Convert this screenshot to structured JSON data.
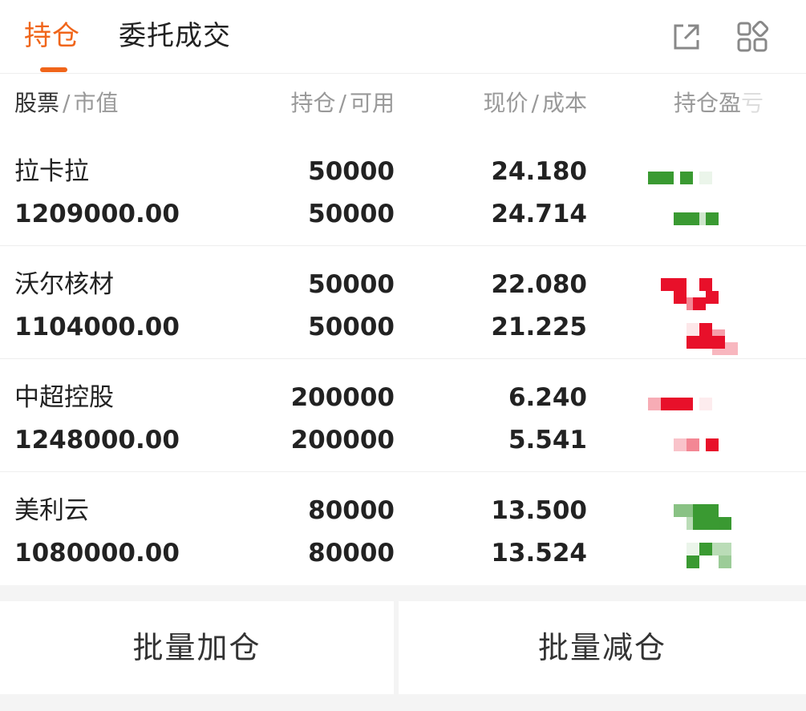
{
  "tabs": [
    {
      "label": "持仓",
      "active": true
    },
    {
      "label": "委托成交",
      "active": false
    }
  ],
  "icons": {
    "share": "external-link-icon",
    "apps": "grid-apps-icon"
  },
  "header": {
    "name_main": "股票",
    "name_sub": "市值",
    "pos_main": "持仓",
    "pos_sub": "可用",
    "price_main": "现价",
    "price_sub": "成本",
    "pl_main": "持仓盈",
    "pl_fade": "亏",
    "separator": "/"
  },
  "holdings": [
    {
      "name": "拉卡拉",
      "market_value": "1209000.00",
      "position": "50000",
      "available": "50000",
      "price": "24.180",
      "cost": "24.714",
      "pl_color": "#3a9a32",
      "pl_direction": "loss"
    },
    {
      "name": "沃尔核材",
      "market_value": "1104000.00",
      "position": "50000",
      "available": "50000",
      "price": "22.080",
      "cost": "21.225",
      "pl_color": "#e8102a",
      "pl_direction": "gain"
    },
    {
      "name": "中超控股",
      "market_value": "1248000.00",
      "position": "200000",
      "available": "200000",
      "price": "6.240",
      "cost": "5.541",
      "pl_color": "#e8102a",
      "pl_direction": "gain"
    },
    {
      "name": "美利云",
      "market_value": "1080000.00",
      "position": "80000",
      "available": "80000",
      "price": "13.500",
      "cost": "13.524",
      "pl_color": "#3a9a32",
      "pl_direction": "loss"
    }
  ],
  "actions": {
    "add": "批量加仓",
    "reduce": "批量减仓"
  },
  "colors": {
    "accent": "#f0651a",
    "gain": "#e8102a",
    "loss": "#3a9a32",
    "muted": "#999999"
  }
}
